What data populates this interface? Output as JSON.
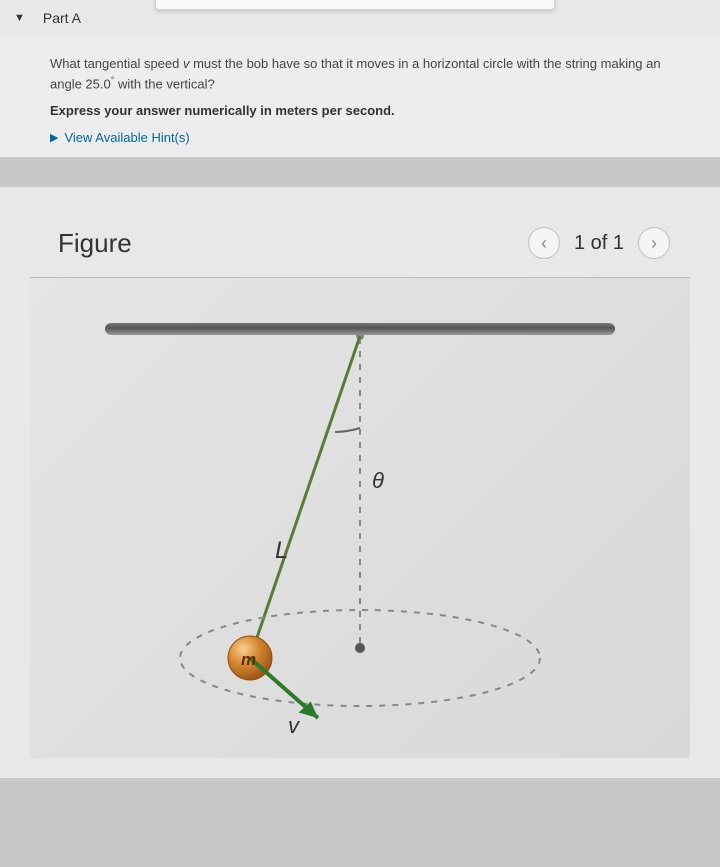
{
  "part": {
    "label": "Part A"
  },
  "question": {
    "text_part1": "What tangential speed ",
    "var_v": "v",
    "text_part2": " must the bob have so that it moves in a horizontal circle with the string making an angle 25.0",
    "degree": "°",
    "text_part3": " with the vertical?"
  },
  "instruction": "Express your answer numerically in meters per second.",
  "hints": {
    "label": "View Available Hint(s)"
  },
  "figure": {
    "title": "Figure",
    "pager": "1 of 1",
    "labels": {
      "theta": "θ",
      "length": "L",
      "mass": "m",
      "velocity": "v"
    }
  }
}
